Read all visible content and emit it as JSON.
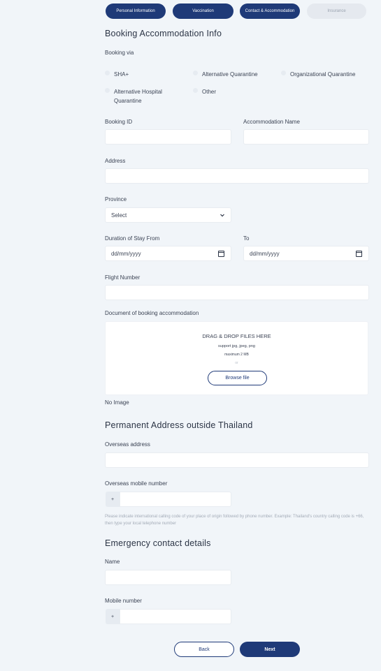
{
  "stepper": [
    {
      "label": "Personal Information"
    },
    {
      "label": "Vaccination"
    },
    {
      "label": "Contact & Accommodation"
    },
    {
      "label": "Insurance"
    }
  ],
  "booking": {
    "title": "Booking Accommodation Info",
    "via_label": "Booking via",
    "options": [
      "SHA+",
      "Alternative Quarantine",
      "Organizational Quarantine",
      "Alternative Hospital Quarantine",
      "Other"
    ],
    "booking_id_label": "Booking ID",
    "accommodation_name_label": "Accommodation Name",
    "address_label": "Address",
    "province_label": "Province",
    "province_value": "Select",
    "duration_from_label": "Duration of Stay From",
    "duration_to_label": "To",
    "date_placeholder": "dd/mm/yyyy",
    "flight_label": "Flight Number",
    "document_label": "Document of booking accommodation",
    "dropzone": {
      "title": "DRAG & DROP FILES HERE",
      "support": "support jpg, jpeg, png",
      "maximum": "maximum 2 MB",
      "or": "or",
      "browse": "Browse file"
    },
    "no_image": "No Image"
  },
  "permanent": {
    "title": "Permanent Address outside Thailand",
    "overseas_address_label": "Overseas address",
    "overseas_mobile_label": "Overseas mobile number",
    "prefix": "+",
    "help": "Please indicate international calling code of your place of origin followed by phone number. Example: Thailand's country calling code is +66, then type your local telephone number"
  },
  "emergency": {
    "title": "Emergency contact details",
    "name_label": "Name",
    "mobile_label": "Mobile number",
    "prefix": "+"
  },
  "actions": {
    "back": "Back",
    "next": "Next"
  },
  "colors": {
    "primary": "#1f3a78",
    "background": "#f1f5f9",
    "inactive_step": "#e5e9ef"
  },
  "icons": {
    "select": "chevron-down-icon",
    "date": "calendar-icon"
  }
}
